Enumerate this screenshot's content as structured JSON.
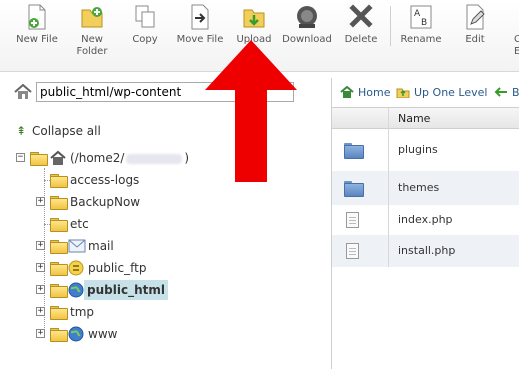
{
  "toolbar": {
    "buttons": [
      {
        "label": "New File",
        "icon": "new-file-icon"
      },
      {
        "label": "New\nFolder",
        "icon": "new-folder-icon"
      },
      {
        "label": "Copy",
        "icon": "copy-icon"
      },
      {
        "label": "Move File",
        "icon": "move-file-icon"
      },
      {
        "label": "Upload",
        "icon": "upload-icon"
      },
      {
        "label": "Download",
        "icon": "download-icon"
      },
      {
        "label": "Delete",
        "icon": "delete-icon"
      },
      {
        "label": "Rename",
        "icon": "rename-icon"
      },
      {
        "label": "Edit",
        "icon": "edit-icon"
      },
      {
        "label": "C\nE",
        "icon": "code-editor-icon"
      }
    ]
  },
  "path": {
    "value": "public_html/wp-content"
  },
  "tree": {
    "collapse_label": "Collapse all",
    "root_label_prefix": "(/home2/",
    "root_label_suffix": ")",
    "items": [
      {
        "label": "access-logs",
        "toggle": ""
      },
      {
        "label": "BackupNow",
        "toggle": "+"
      },
      {
        "label": "etc",
        "toggle": ""
      },
      {
        "label": "mail",
        "toggle": "+"
      },
      {
        "label": "public_ftp",
        "toggle": "+"
      },
      {
        "label": "public_html",
        "toggle": "+"
      },
      {
        "label": "tmp",
        "toggle": "+"
      },
      {
        "label": "www",
        "toggle": "+"
      }
    ]
  },
  "nav": {
    "home": "Home",
    "up_one_level": "Up One Level",
    "back": "B"
  },
  "grid": {
    "column_name": "Name",
    "rows": [
      {
        "name": "plugins",
        "type": "folder"
      },
      {
        "name": "themes",
        "type": "folder"
      },
      {
        "name": "index.php",
        "type": "file"
      },
      {
        "name": "install.php",
        "type": "file"
      }
    ]
  },
  "colors": {
    "selection": "#c6e2e8",
    "arrow": "#ee0000",
    "row_alt": "#eef2f7"
  }
}
